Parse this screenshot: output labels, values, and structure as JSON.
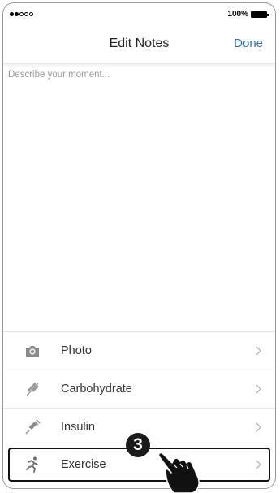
{
  "status_bar": {
    "signal_filled": 2,
    "signal_empty": 3,
    "battery_text": "100%"
  },
  "nav": {
    "title": "Edit Notes",
    "done_label": "Done",
    "accent_color": "#2e74b5"
  },
  "notes": {
    "placeholder": "Describe your moment..."
  },
  "menu": {
    "items": [
      {
        "label": "Photo",
        "icon": "camera-icon"
      },
      {
        "label": "Carbohydrate",
        "icon": "wheat-icon"
      },
      {
        "label": "Insulin",
        "icon": "syringe-icon"
      },
      {
        "label": "Exercise",
        "icon": "running-icon",
        "selected": true
      }
    ]
  },
  "callout": {
    "step": "3",
    "pointer_icon": "pointing-hand-icon"
  }
}
